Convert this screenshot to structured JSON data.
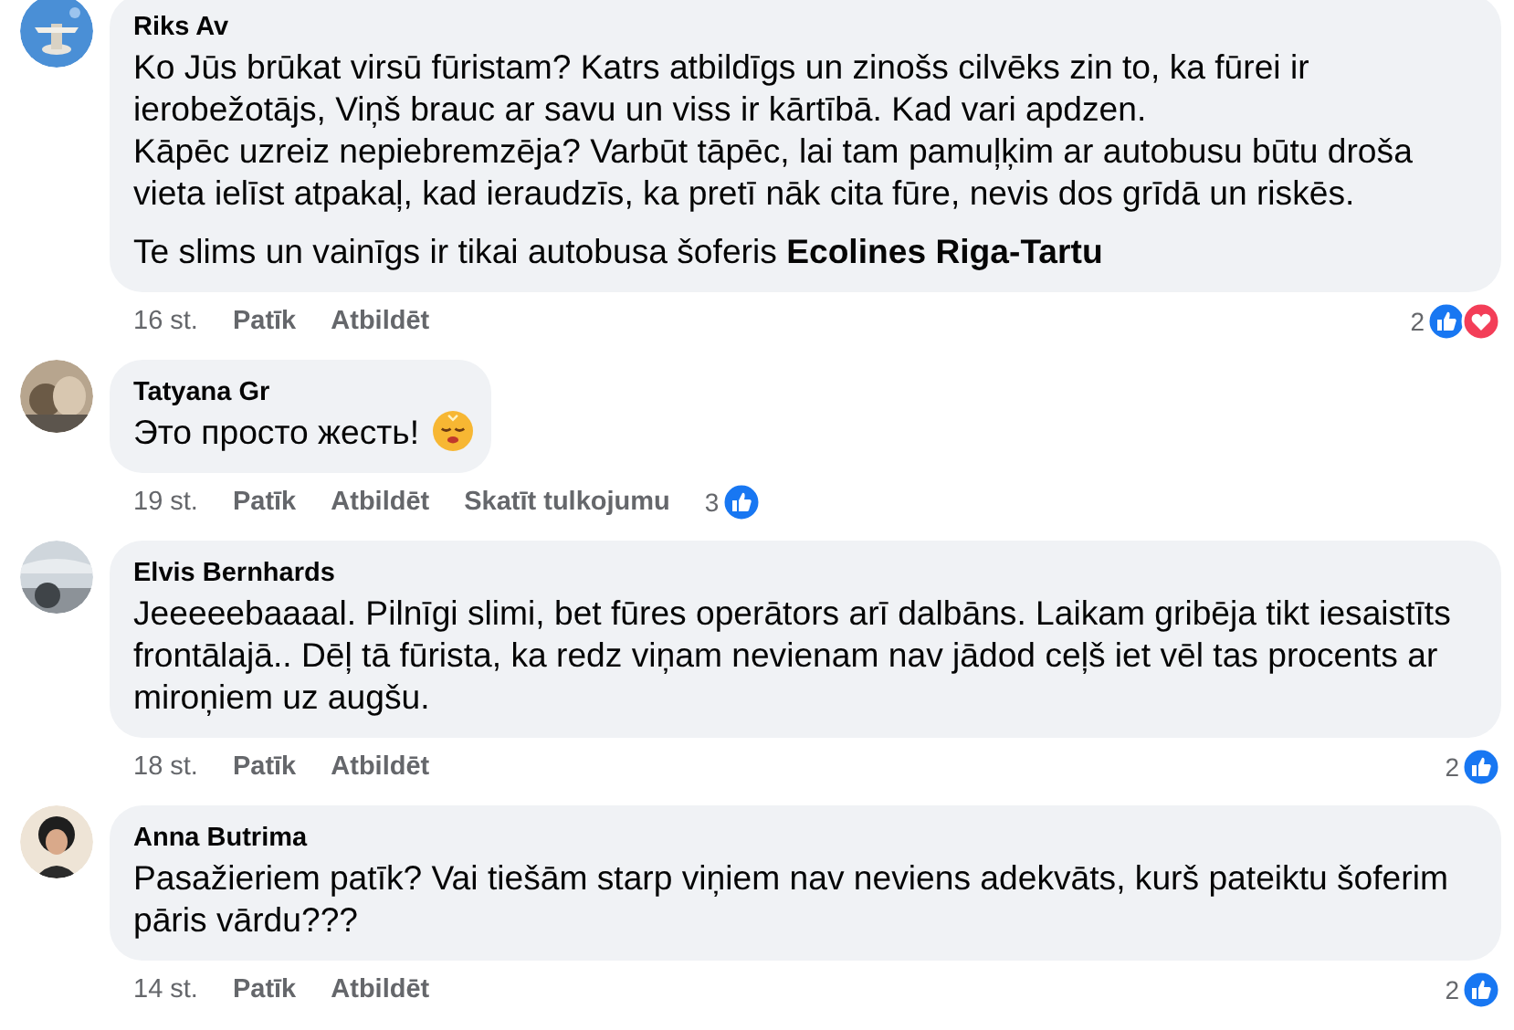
{
  "comments": [
    {
      "author": "Riks Av",
      "paragraphs": [
        [
          "Ko Jūs brūkat virsū fūristam? Katrs atbildīgs un zinošs cilvēks zin to, ka fūrei ir ierobežotājs, Viņš brauc ar savu un viss ir kārtībā. Kad vari apdzen.",
          "Kāpēc uzreiz nepiebremzēja? Varbūt tāpēc, lai tam pamuļķim ar autobusu būtu droša vieta ielīst atpakaļ, kad ieraudzīs, ka pretī nāk cita fūre, nevis dos grīdā un riskēs."
        ],
        [
          "Te slims un vainīgs ir tikai autobusa šoferis **Ecolines Riga-Tartu**"
        ]
      ],
      "actions": [
        {
          "kind": "time",
          "label": "16 st."
        },
        {
          "kind": "like",
          "label": "Patīk"
        },
        {
          "kind": "reply",
          "label": "Atbildēt"
        }
      ],
      "reactions": {
        "count": "2",
        "items": [
          {
            "kind": "like"
          },
          {
            "kind": "love"
          }
        ]
      }
    },
    {
      "author": "Tatyana Gr",
      "paragraphs": [
        [
          "Это просто жесть!"
        ]
      ],
      "emoji": {
        "kind": "face"
      },
      "actions": [
        {
          "kind": "time",
          "label": "19 st."
        },
        {
          "kind": "like",
          "label": "Patīk"
        },
        {
          "kind": "reply",
          "label": "Atbildēt"
        },
        {
          "kind": "translate",
          "label": "Skatīt tulkojumu"
        }
      ],
      "reactions": {
        "count": "3",
        "items": [
          {
            "kind": "like"
          }
        ]
      }
    },
    {
      "author": "Elvis Bernhards",
      "paragraphs": [
        [
          "Jeeeeebaaaal. Pilnīgi slimi, bet fūres operātors arī dalbāns. Laikam gribēja tikt iesaistīts frontālajā.. Dēļ tā fūrista, ka redz viņam nevienam nav jādod ceļš iet vēl tas procents ar miroņiem uz augšu."
        ]
      ],
      "actions": [
        {
          "kind": "time",
          "label": "18 st."
        },
        {
          "kind": "like",
          "label": "Patīk"
        },
        {
          "kind": "reply",
          "label": "Atbildēt"
        }
      ],
      "reactions": {
        "count": "2",
        "items": [
          {
            "kind": "like"
          }
        ]
      }
    },
    {
      "author": "Anna Butrima",
      "paragraphs": [
        [
          "Pasažieriem patīk? Vai tiešām starp viņiem nav neviens adekvāts, kurš pateiktu šoferim pāris vārdu???"
        ]
      ],
      "actions": [
        {
          "kind": "time",
          "label": "14 st."
        },
        {
          "kind": "like",
          "label": "Patīk"
        },
        {
          "kind": "reply",
          "label": "Atbildēt"
        }
      ],
      "reactions": {
        "count": "2",
        "items": [
          {
            "kind": "like"
          }
        ]
      }
    }
  ]
}
